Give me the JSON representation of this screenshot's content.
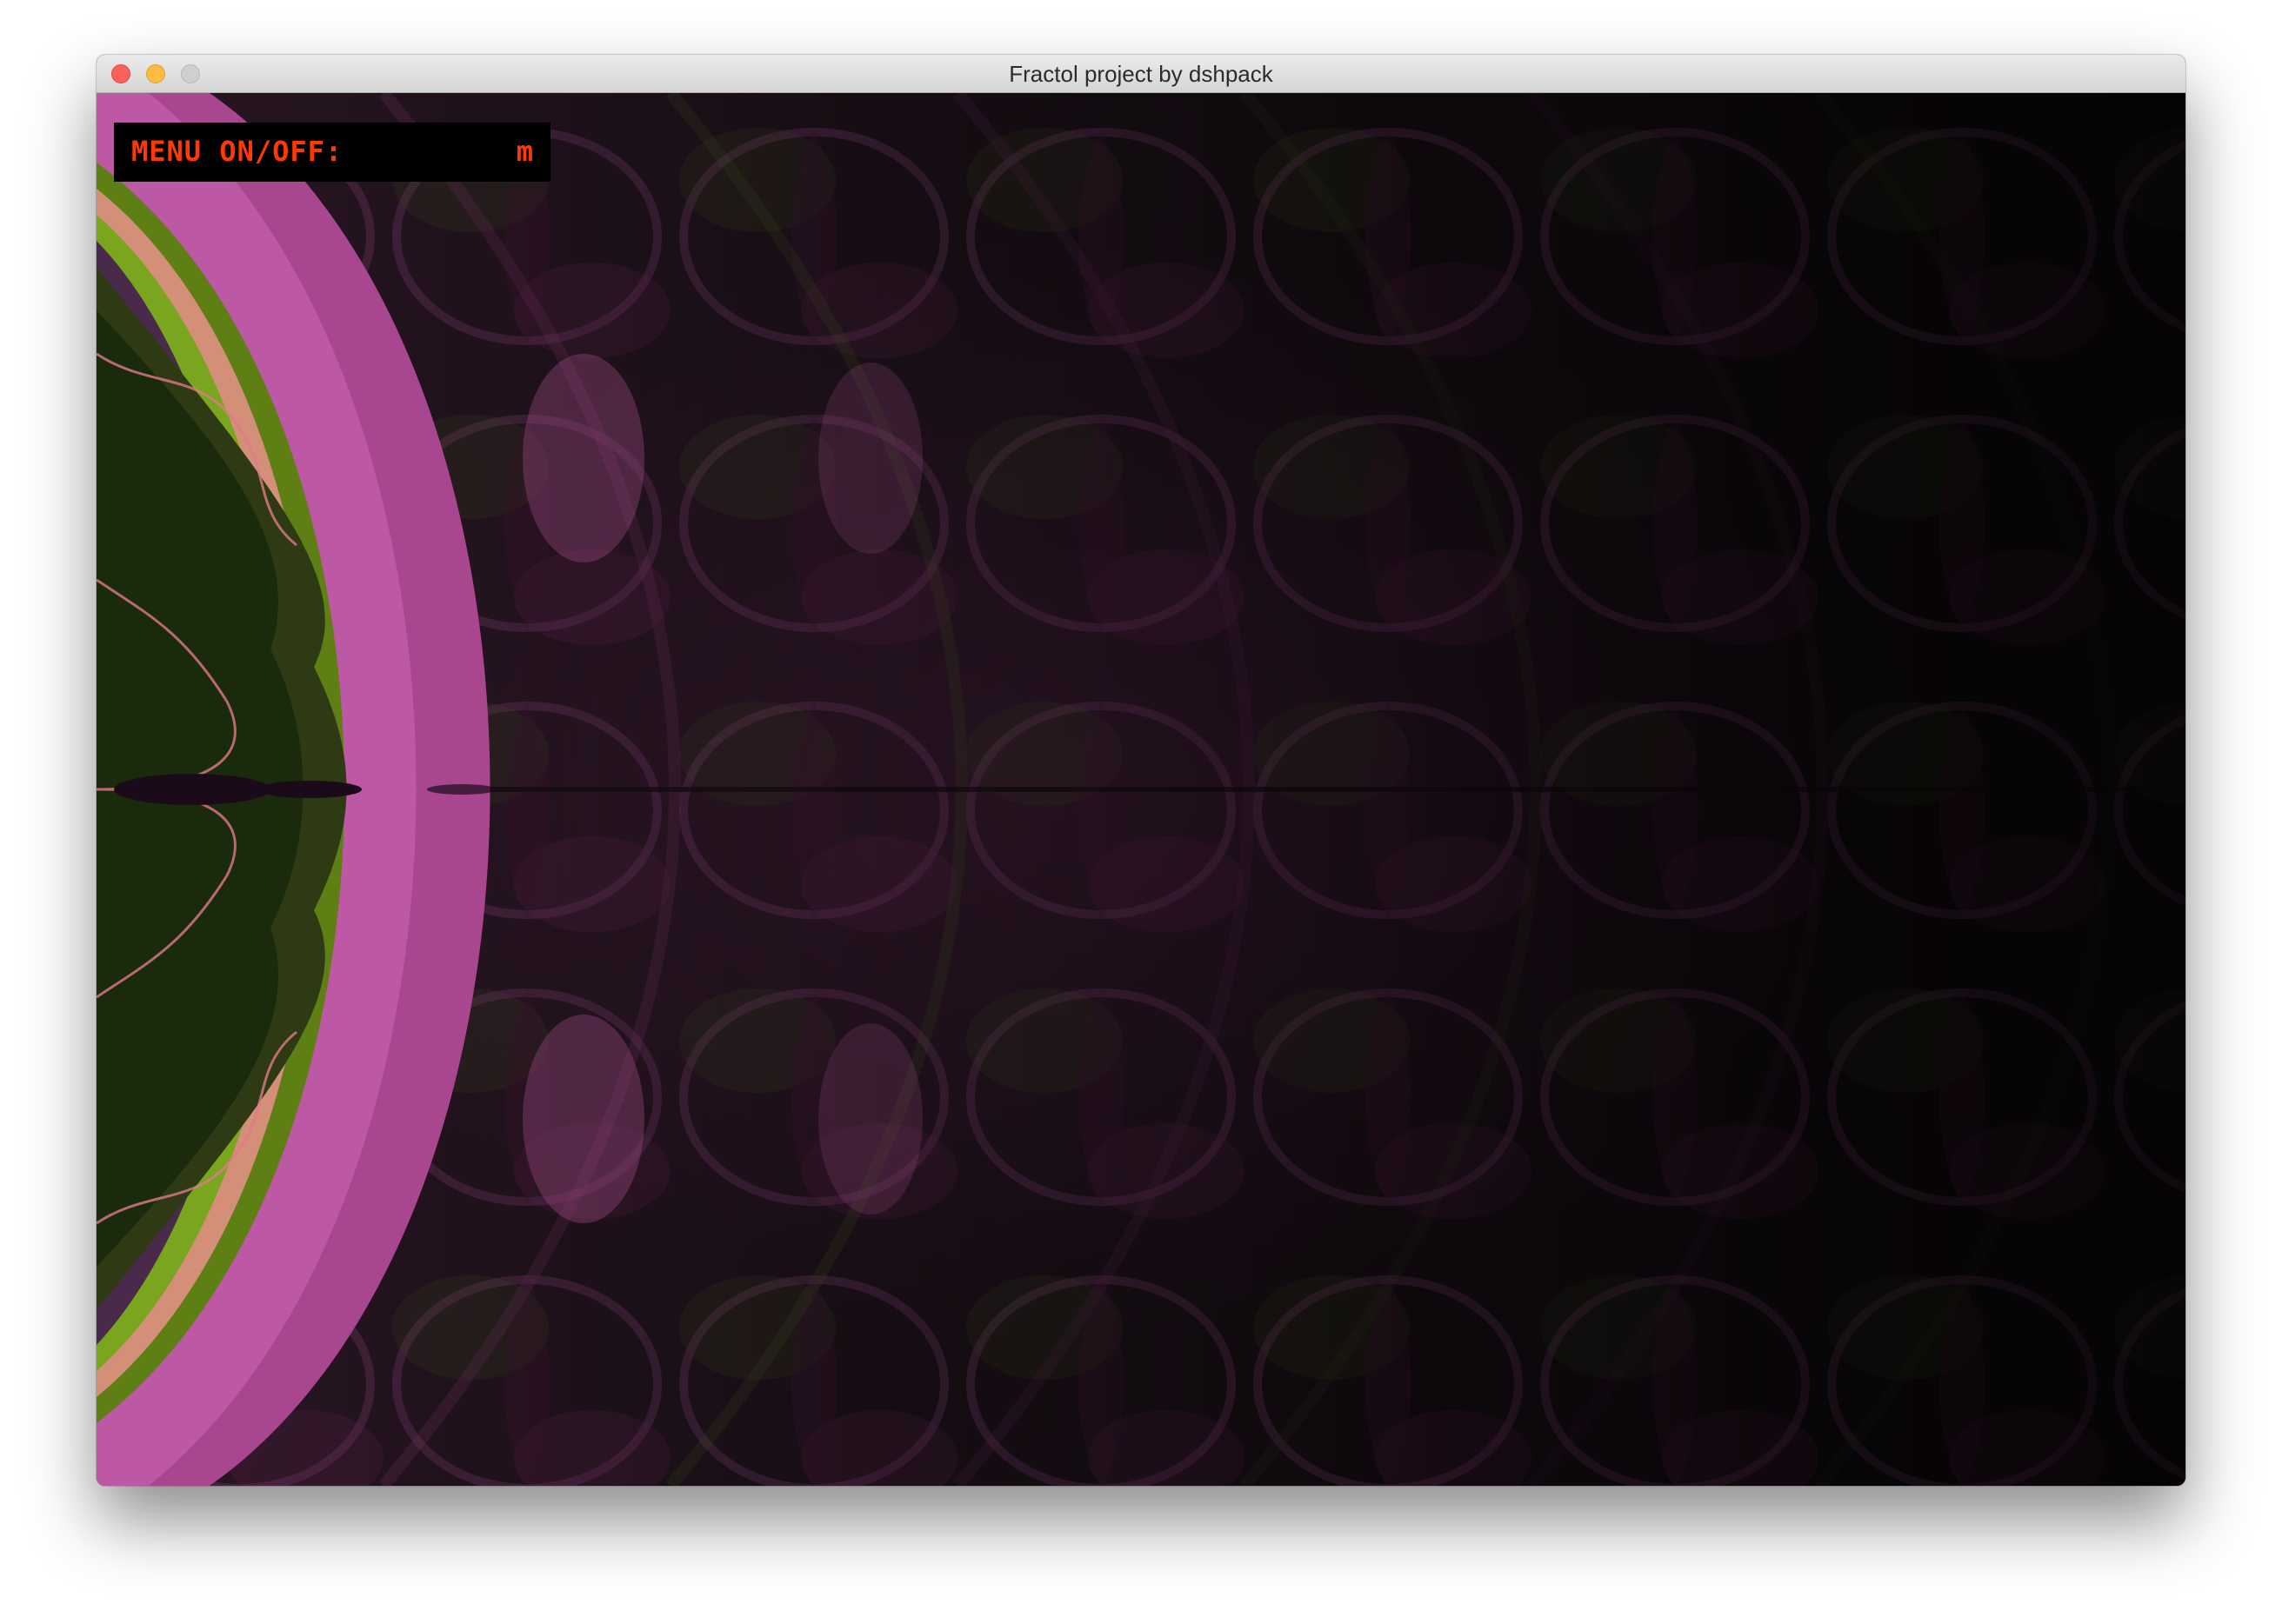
{
  "window": {
    "title": "Fractol project by dshpack"
  },
  "overlay": {
    "menu_label": "MENU ON/OFF:",
    "menu_key": "m"
  },
  "colors": {
    "accent_text": "#ff3a00",
    "fractal_magenta": "#b04a9a",
    "fractal_green": "#6f9a1a",
    "fractal_peach": "#d9927a",
    "background": "#0b0708"
  }
}
